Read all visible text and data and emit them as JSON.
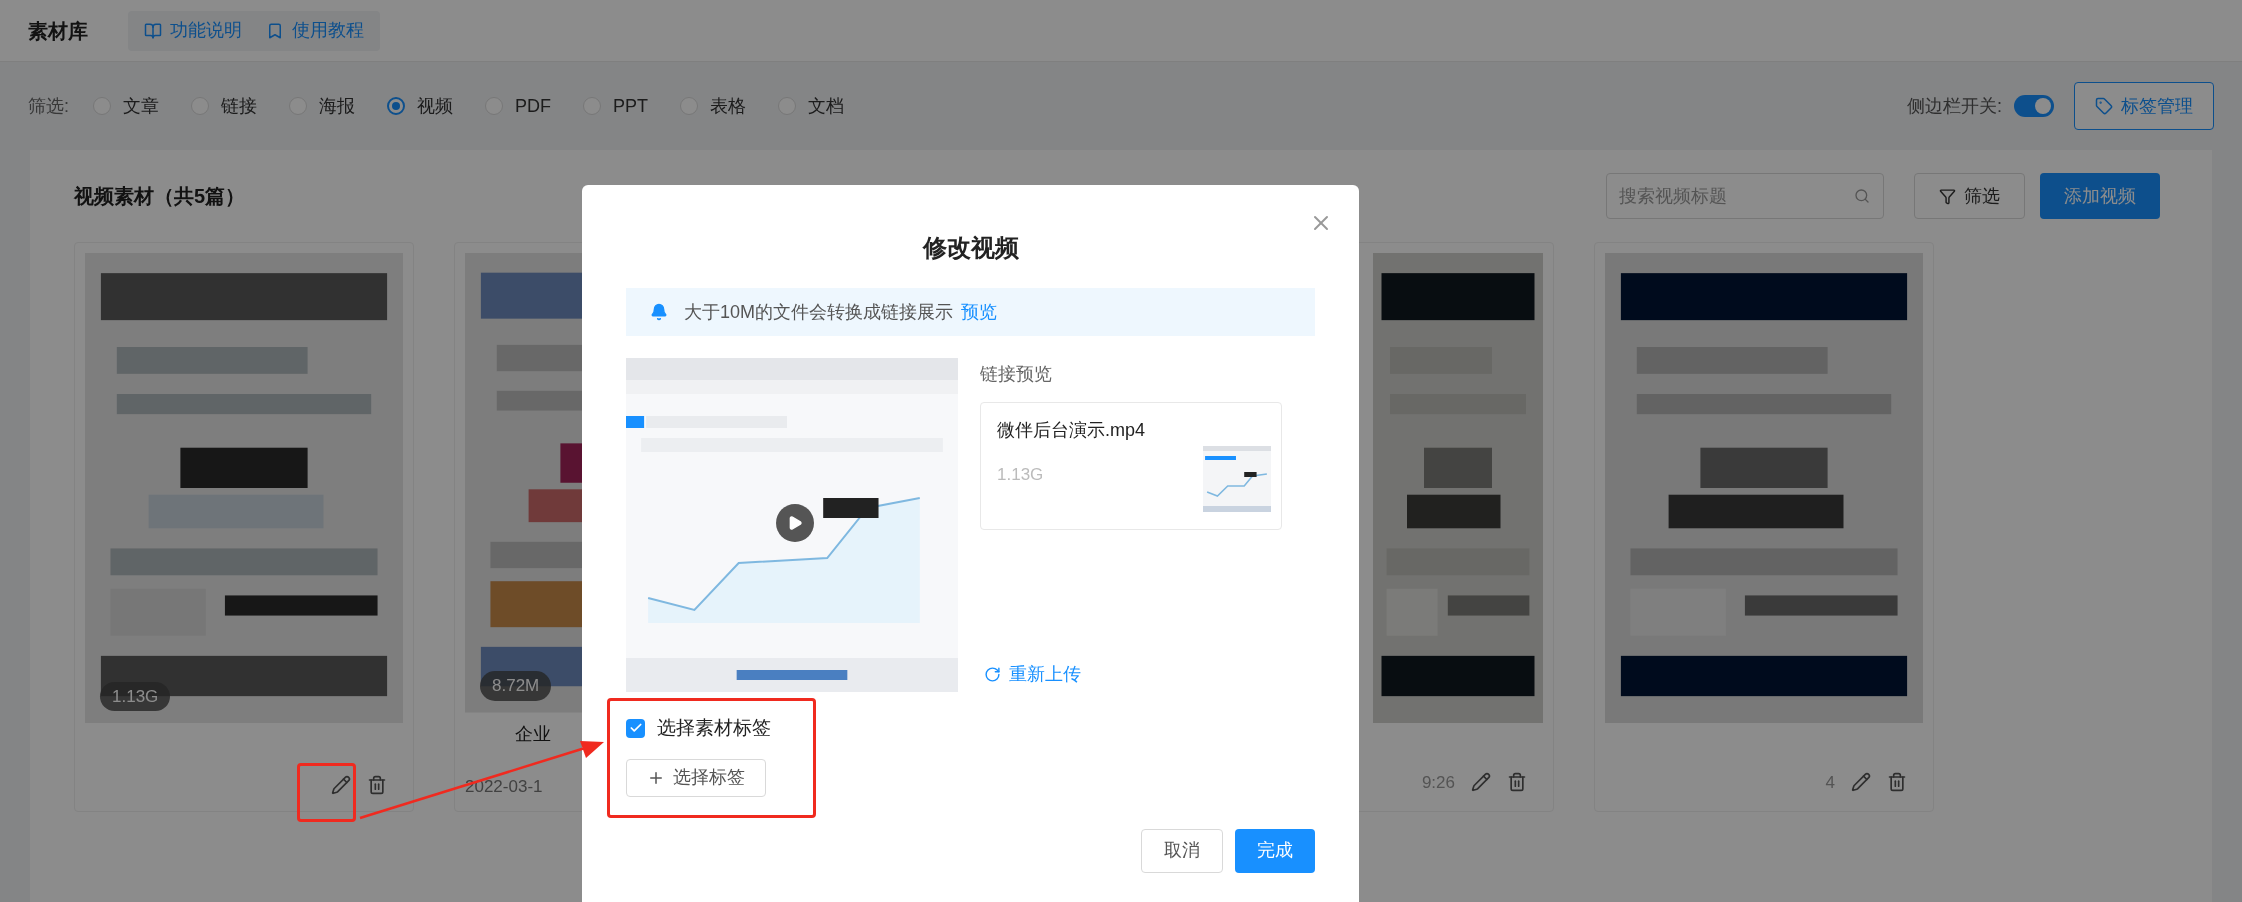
{
  "header": {
    "title": "素材库",
    "links": [
      {
        "label": "功能说明"
      },
      {
        "label": "使用教程"
      }
    ]
  },
  "filter": {
    "label": "筛选:",
    "options": [
      {
        "label": "文章",
        "selected": false
      },
      {
        "label": "链接",
        "selected": false
      },
      {
        "label": "海报",
        "selected": false
      },
      {
        "label": "视频",
        "selected": true
      },
      {
        "label": "PDF",
        "selected": false
      },
      {
        "label": "PPT",
        "selected": false
      },
      {
        "label": "表格",
        "selected": false
      },
      {
        "label": "文档",
        "selected": false
      }
    ]
  },
  "sidebar_toggle": {
    "label": "侧边栏开关:",
    "on": true
  },
  "tag_manage_button": "标签管理",
  "section": {
    "title": "视频素材（共5篇）",
    "search": {
      "placeholder": "搜索视频标题"
    },
    "filter_button": "筛选",
    "add_button": "添加视频"
  },
  "cards": [
    {
      "badge": "1.13G"
    },
    {
      "badge": "8.72M",
      "caption": "企业",
      "date": "2022-03-1"
    },
    {
      "meta": "9:26"
    },
    {
      "meta": "4"
    }
  ],
  "dialog": {
    "title": "修改视频",
    "notice": {
      "text": "大于10M的文件会转换成链接展示",
      "link": "预览"
    },
    "link_preview": {
      "label": "链接预览",
      "file_name": "微伴后台演示.mp4",
      "size": "1.13G"
    },
    "reupload": "重新上传",
    "tag_checkbox": {
      "label": "选择素材标签",
      "checked": true
    },
    "select_tag_button": "选择标签",
    "buttons": [
      {
        "label": "取消",
        "kind": "secondary"
      },
      {
        "label": "完成",
        "kind": "primary"
      }
    ]
  }
}
